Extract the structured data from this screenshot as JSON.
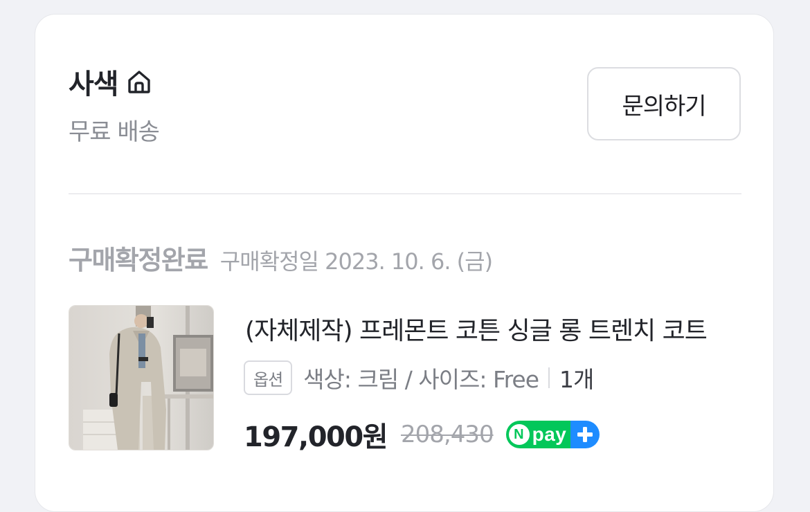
{
  "store": {
    "name": "사색",
    "icon": "home-icon",
    "shipping": "무료 배송",
    "inquiry_label": "문의하기"
  },
  "order": {
    "status": "구매확정완료",
    "confirm_date": "구매확정일 2023. 10. 6. (금)"
  },
  "product": {
    "name": "(자체제작) 프레몬트 코튼 싱글 롱 트렌치 코트",
    "option_badge": "옵션",
    "option_text": "색상: 크림 / 사이즈: Free",
    "quantity": "1개",
    "price": "197,000원",
    "original_price": "208,430",
    "pay_badge": "pay",
    "pay_badge_n": "N"
  },
  "colors": {
    "npay_green": "#03c75a",
    "npay_blue": "#1e8cff",
    "muted_text": "#a3a5ab"
  }
}
